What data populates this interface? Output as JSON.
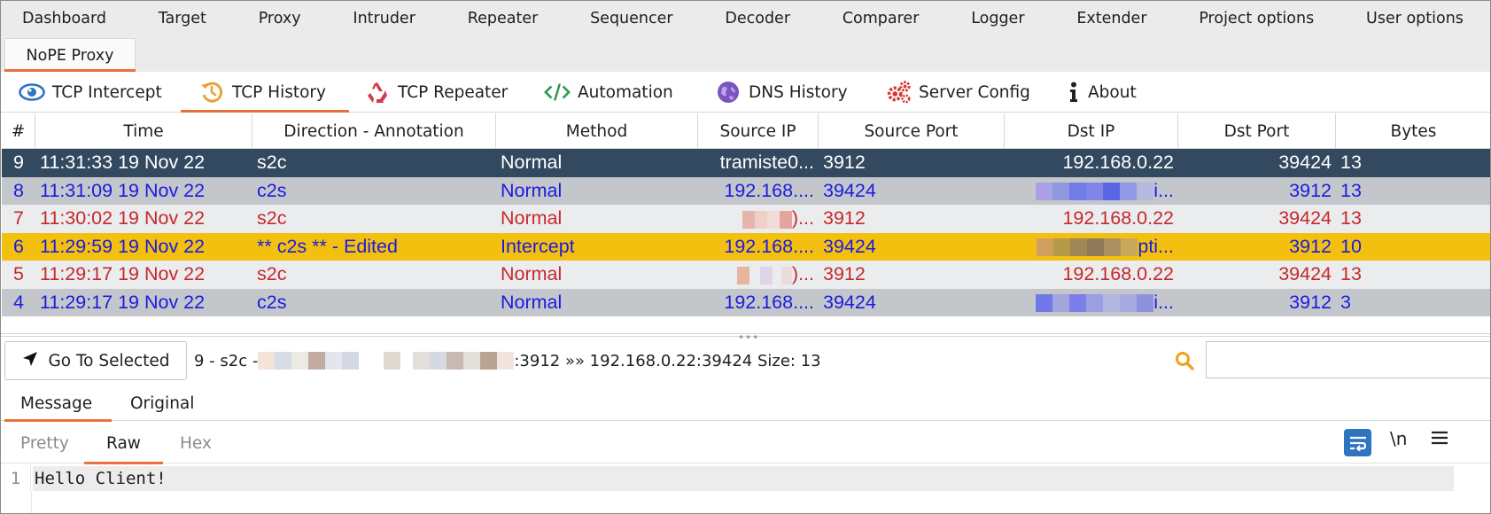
{
  "main_tabs": [
    "Dashboard",
    "Target",
    "Proxy",
    "Intruder",
    "Repeater",
    "Sequencer",
    "Decoder",
    "Comparer",
    "Logger",
    "Extender",
    "Project options",
    "User options"
  ],
  "extension_tab": "NoPE Proxy",
  "tool_tabs": {
    "intercept": "TCP Intercept",
    "history": "TCP History",
    "repeater": "TCP Repeater",
    "automation": "Automation",
    "dns": "DNS History",
    "server": "Server Config",
    "about": "About"
  },
  "table": {
    "columns": [
      "#",
      "Time",
      "Direction - Annotation",
      "Method",
      "Source IP",
      "Source Port",
      "Dst IP",
      "Dst Port",
      "Bytes"
    ],
    "rows": [
      {
        "id": "9",
        "time": "11:31:33 19 Nov 22",
        "direction": "s2c",
        "method": "Normal",
        "src_ip": "tramiste0...",
        "src_port": "3912",
        "dst_ip": "192.168.0.22",
        "dst_port": "39424",
        "bytes": "13"
      },
      {
        "id": "8",
        "time": "11:31:09 19 Nov 22",
        "direction": "c2s",
        "method": "Normal",
        "src_ip": "192.168....",
        "src_port": "39424",
        "dst_ip": "i...",
        "dst_port": "3912",
        "bytes": "13"
      },
      {
        "id": "7",
        "time": "11:30:02 19 Nov 22",
        "direction": "s2c",
        "method": "Normal",
        "src_ip": ")...",
        "src_port": "3912",
        "dst_ip": "192.168.0.22",
        "dst_port": "39424",
        "bytes": "13"
      },
      {
        "id": "6",
        "time": "11:29:59 19 Nov 22",
        "direction": "** c2s ** - Edited",
        "method": "Intercept",
        "src_ip": "192.168....",
        "src_port": "39424",
        "dst_ip": "pti...",
        "dst_port": "3912",
        "bytes": "10"
      },
      {
        "id": "5",
        "time": "11:29:17 19 Nov 22",
        "direction": "s2c",
        "method": "Normal",
        "src_ip": ")...",
        "src_port": "3912",
        "dst_ip": "192.168.0.22",
        "dst_port": "39424",
        "bytes": "13"
      },
      {
        "id": "4",
        "time": "11:29:17 19 Nov 22",
        "direction": "c2s",
        "method": "Normal",
        "src_ip": "192.168....",
        "src_port": "39424",
        "dst_ip": "i...",
        "dst_port": "3912",
        "bytes": "3"
      }
    ]
  },
  "selection": {
    "goto_label": "Go To Selected",
    "info_prefix": "9 - s2c - ",
    "info_suffix": ":3912 »» 192.168.0.22:39424 Size: 13",
    "search_value": ""
  },
  "message_tabs": {
    "message": "Message",
    "original": "Original"
  },
  "editor": {
    "tabs": {
      "pretty": "Pretty",
      "raw": "Raw",
      "hex": "Hex"
    },
    "newline_toggle": "\\n",
    "line_number": "1",
    "content": "Hello Client!"
  },
  "colors": {
    "selected_row_bg": "#33495f",
    "gray_row_bg": "#c3c7cc",
    "light_row_bg": "#eaecee",
    "intercept_row_bg": "#f3c010",
    "blue_text": "#1b1bdf",
    "red_text": "#c7292b",
    "accent": "#e8703a"
  }
}
